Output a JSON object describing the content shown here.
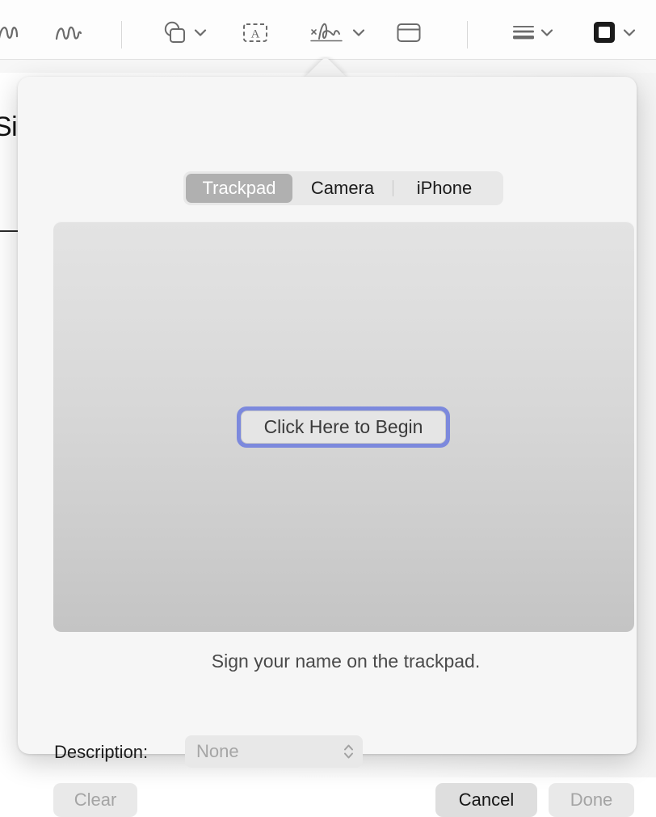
{
  "toolbar": {
    "items": [
      {
        "name": "sketch-tool",
        "icon": "squiggle-partial-icon",
        "has_chevron": false
      },
      {
        "name": "draw-tool",
        "icon": "squiggle-icon",
        "has_chevron": false
      },
      {
        "name": "shapes-tool",
        "icon": "shapes-icon",
        "has_chevron": true
      },
      {
        "name": "text-tool",
        "icon": "text-box-icon",
        "has_chevron": false
      },
      {
        "name": "signature-tool",
        "icon": "signature-icon",
        "has_chevron": true
      },
      {
        "name": "note-tool",
        "icon": "note-icon",
        "has_chevron": false
      },
      {
        "name": "style-tool",
        "icon": "lines-icon",
        "has_chevron": true
      },
      {
        "name": "border-tool",
        "icon": "square-border-icon",
        "has_chevron": true
      }
    ]
  },
  "document": {
    "visible_text": "Sig"
  },
  "popover": {
    "segmented_control": {
      "options": [
        "Trackpad",
        "Camera",
        "iPhone"
      ],
      "selected": "Trackpad",
      "selected_index": 0
    },
    "capture_area": {
      "begin_button_label": "Click Here to Begin",
      "focus_ring_color": "#7c89dd",
      "gradient_top": "#e3e3e3",
      "gradient_bottom": "#c4c4c4"
    },
    "hint_text": "Sign your name on the trackpad.",
    "description": {
      "label": "Description:",
      "value": "None",
      "enabled": false,
      "chevron_icon": "chevron-up-down-icon"
    },
    "buttons": {
      "clear": {
        "label": "Clear",
        "enabled": false
      },
      "cancel": {
        "label": "Cancel",
        "enabled": true
      },
      "done": {
        "label": "Done",
        "enabled": false
      }
    }
  }
}
